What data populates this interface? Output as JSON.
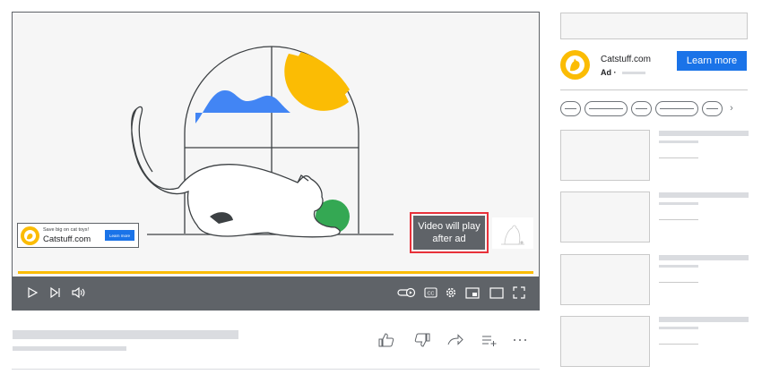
{
  "player": {
    "progress": 1.0,
    "banner_ad": {
      "tagline": "Save big on cat toys!",
      "site": "Catstuff.com",
      "button": "Learn more"
    },
    "will_play": "Video will play after ad",
    "controls": [
      "play-icon",
      "next-icon",
      "volume-icon",
      "autoplay-toggle-icon",
      "captions-icon",
      "settings-icon",
      "miniplayer-icon",
      "theater-icon",
      "fullscreen-icon"
    ],
    "captions_label": "CC"
  },
  "actions": [
    "like-icon",
    "dislike-icon",
    "share-icon",
    "save-icon",
    "more-icon"
  ],
  "sidebar": {
    "ad": {
      "site": "Catstuff.com",
      "ad_label": "Ad ·",
      "button": "Learn more"
    },
    "next_chip": "›"
  },
  "colors": {
    "brand_yellow": "#fbbc04",
    "button_blue": "#1a73e8",
    "control_gray": "#5f6368",
    "highlight_red": "#e8313a",
    "ball_green": "#34a853",
    "cloud_blue": "#4285f4"
  }
}
